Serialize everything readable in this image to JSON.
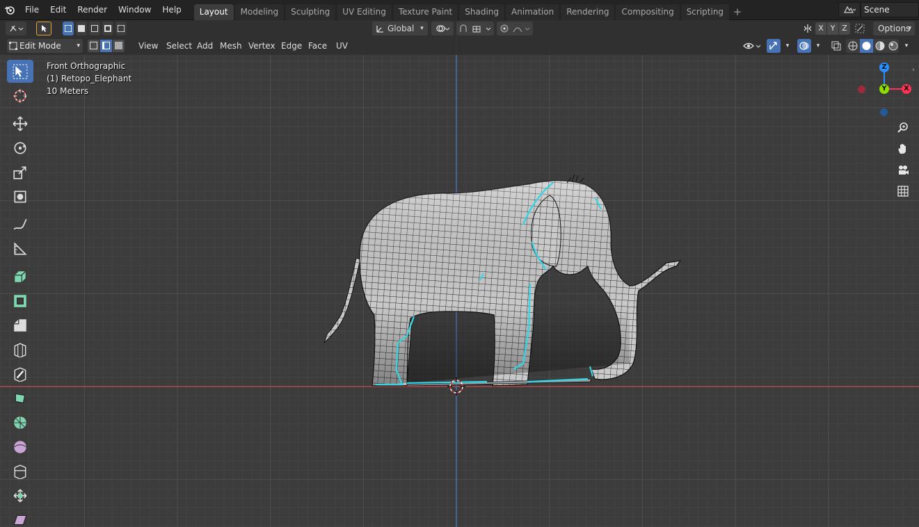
{
  "topbar": {
    "menus": [
      "File",
      "Edit",
      "Render",
      "Window",
      "Help"
    ],
    "workspaces": [
      "Layout",
      "Modeling",
      "Sculpting",
      "UV Editing",
      "Texture Paint",
      "Shading",
      "Animation",
      "Rendering",
      "Compositing",
      "Scripting"
    ],
    "active_workspace": "Layout",
    "add_workspace": "+",
    "scene_name": "Scene"
  },
  "toolheader": {
    "orientation": "Global",
    "axis_x": "X",
    "axis_y": "Y",
    "axis_z": "Z",
    "options": "Options"
  },
  "vpheader": {
    "mode": "Edit Mode",
    "menus": [
      "View",
      "Select",
      "Add",
      "Mesh",
      "Vertex",
      "Edge",
      "Face",
      "UV"
    ],
    "select_mode_active": "edge"
  },
  "overlay": {
    "view_name": "Front Orthographic",
    "object_name": "(1) Retopo_Elephant",
    "scale_label": "10 Meters"
  },
  "gizmo": {
    "z_label": "Z",
    "y_label": "Y",
    "x_label": "X",
    "colors": {
      "x": "#ff3352",
      "y": "#8bdc00",
      "z": "#2890ff"
    }
  },
  "toolbar": {
    "tools": [
      "select-box-icon",
      "cursor-icon",
      "move-icon",
      "rotate-icon",
      "scale-icon",
      "transform-icon",
      "annotate-icon",
      "measure-icon",
      "extrude-icon",
      "inset-icon",
      "bevel-icon",
      "loop-cut-icon",
      "knife-icon",
      "poly-build-icon",
      "spin-icon",
      "smooth-icon",
      "edge-slide-icon",
      "shrink-fatten-icon",
      "shear-icon"
    ],
    "active_tool": "select-box-icon"
  },
  "colors": {
    "accent": "#4772b3",
    "viewport_bg": "#3c3c3c",
    "selection": "#31d7e6",
    "x_axis_line": "#c94a4a",
    "z_axis_line": "#4a7fd6"
  }
}
